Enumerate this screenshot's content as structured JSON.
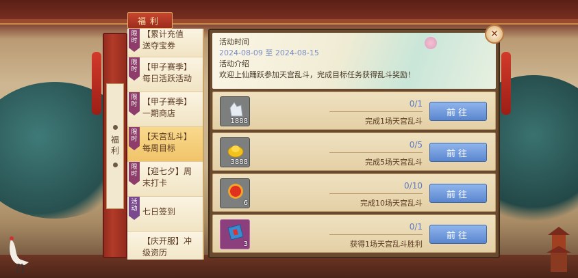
{
  "header": {
    "tab_label": "福利"
  },
  "side": {
    "vertical_label": "福利"
  },
  "categories": [
    {
      "tag": "限时",
      "line1": "【累计充值",
      "line2": "送夺宝券"
    },
    {
      "tag": "限时",
      "line1": "【甲子赛季】",
      "line2": "每日活跃活动"
    },
    {
      "tag": "限时",
      "line1": "【甲子赛季】",
      "line2": "一期商店"
    },
    {
      "tag": "限时",
      "line1": "【天宫乱斗】",
      "line2": "每周目标"
    },
    {
      "tag": "限时",
      "line1": "【迎七夕】周",
      "line2": "末打卡"
    },
    {
      "tag": "活动",
      "line1": "七日签到",
      "line2": ""
    },
    {
      "tag": "",
      "line1": "【庆开服】冲",
      "line2": "级资历"
    }
  ],
  "info": {
    "time_label": "活动时间",
    "date_range": "2024-08-09 至 2024-08-15",
    "intro_label": "活动介绍",
    "intro_text": "欢迎上仙踊跃参加天宫乱斗，完成目标任务获得乱斗奖励！"
  },
  "tasks": [
    {
      "qty": "1888",
      "progress": "0/1",
      "desc": "完成1场天宫乱斗",
      "button": "前往",
      "icon": "silver-ore-icon"
    },
    {
      "qty": "3888",
      "progress": "0/5",
      "desc": "完成5场天宫乱斗",
      "button": "前往",
      "icon": "gold-ingot-icon"
    },
    {
      "qty": "6",
      "progress": "0/10",
      "desc": "完成10场天宫乱斗",
      "button": "前往",
      "icon": "red-gem-icon"
    },
    {
      "qty": "3",
      "progress": "0/1",
      "desc": "获得1场天宫乱斗胜利",
      "button": "前往",
      "icon": "blue-scroll-icon"
    }
  ],
  "colors": {
    "accent_blue": "#5a86cf",
    "active_tab": "#f0c46a",
    "frame_red": "#b23a28"
  }
}
